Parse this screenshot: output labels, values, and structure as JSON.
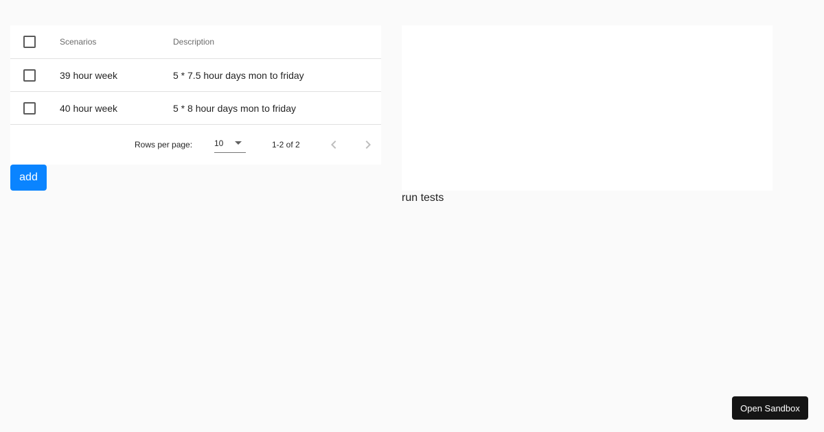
{
  "table": {
    "headers": {
      "scenarios": "Scenarios",
      "description": "Description"
    },
    "rows": [
      {
        "scenario": "39 hour week",
        "description": "5 * 7.5 hour days mon to friday"
      },
      {
        "scenario": "40 hour week",
        "description": "5 * 8 hour days mon to friday"
      }
    ],
    "pagination": {
      "rows_per_page_label": "Rows per page:",
      "rows_per_page_value": "10",
      "range": "1-2 of 2"
    }
  },
  "add_button": {
    "label": "add"
  },
  "run_tests": {
    "label": "run tests"
  },
  "sandbox": {
    "label": "Open Sandbox"
  },
  "colors": {
    "accent": "#0a84ff",
    "sandbox_bg": "#151515",
    "page_bg": "#fafafa"
  },
  "icons": {
    "prev": "chevron-left-icon",
    "next": "chevron-right-icon",
    "dropdown": "caret-down-icon"
  }
}
